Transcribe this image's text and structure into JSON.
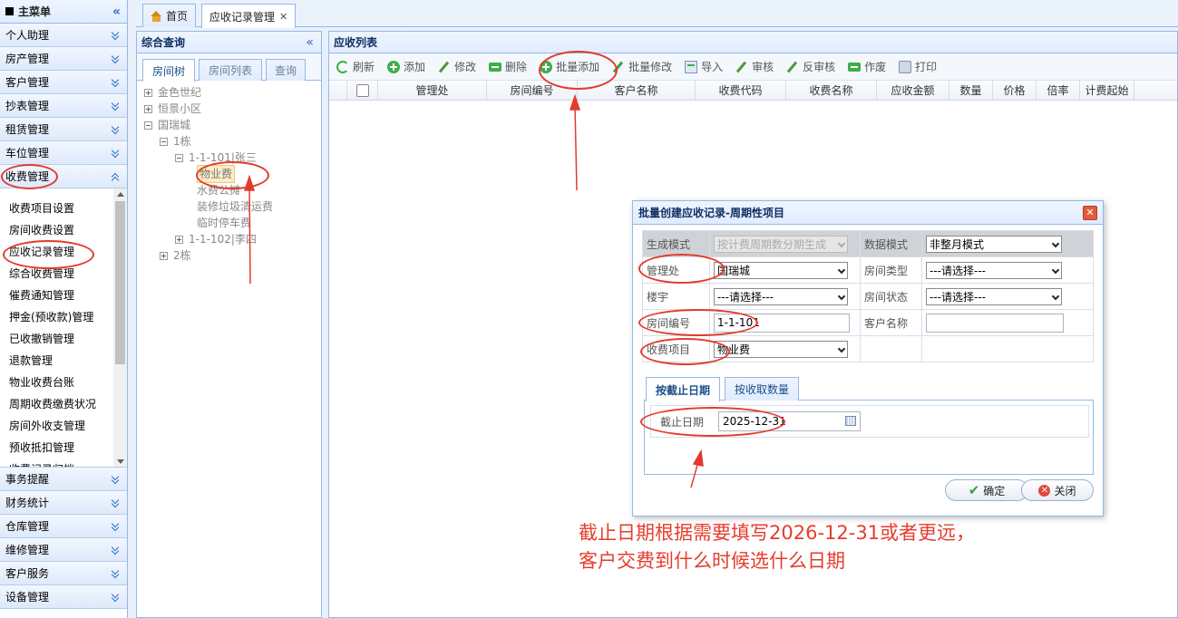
{
  "main_menu": {
    "title": "主菜单",
    "groups_top": [
      "个人助理",
      "房产管理",
      "客户管理",
      "抄表管理",
      "租赁管理",
      "车位管理"
    ],
    "open_group": "收费管理",
    "sub_items": [
      "收费项目设置",
      "房间收费设置",
      "应收记录管理",
      "综合收费管理",
      "催费通知管理",
      "押金(预收款)管理",
      "已收撤销管理",
      "退款管理",
      "物业收费台账",
      "周期收费缴费状况",
      "房间外收支管理",
      "预收抵扣管理",
      "收费记录归档"
    ],
    "groups_bottom": [
      "事务提醒",
      "财务统计",
      "仓库管理",
      "维修管理",
      "客户服务",
      "设备管理"
    ]
  },
  "top_tabs": [
    {
      "label": "首页"
    },
    {
      "label": "应收记录管理"
    }
  ],
  "search_panel": {
    "title": "综合查询",
    "tabs": [
      "房间树",
      "房间列表",
      "查询"
    ],
    "tree": [
      {
        "label": "金色世纪",
        "level": 0,
        "state": "plus"
      },
      {
        "label": "恒景小区",
        "level": 0,
        "state": "plus"
      },
      {
        "label": "国瑞城",
        "level": 0,
        "state": "minus"
      },
      {
        "label": "1栋",
        "level": 1,
        "state": "minus"
      },
      {
        "label": "1-1-101|张三",
        "level": 2,
        "state": "minus"
      },
      {
        "label": "物业费",
        "level": 3,
        "state": "selected"
      },
      {
        "label": "水费公摊",
        "level": 3,
        "state": "leaf"
      },
      {
        "label": "装修垃圾清运费",
        "level": 3,
        "state": "leaf"
      },
      {
        "label": "临时停车费",
        "level": 3,
        "state": "leaf"
      },
      {
        "label": "1-1-102|李四",
        "level": 2,
        "state": "plus"
      },
      {
        "label": "2栋",
        "level": 1,
        "state": "plus"
      }
    ]
  },
  "list_panel": {
    "title": "应收列表",
    "toolbar": [
      "刷新",
      "添加",
      "修改",
      "删除",
      "批量添加",
      "批量修改",
      "导入",
      "审核",
      "反审核",
      "作废",
      "打印"
    ],
    "columns": [
      "管理处",
      "房间编号",
      "客户名称",
      "收费代码",
      "收费名称",
      "应收金额",
      "数量",
      "价格",
      "倍率",
      "计费起始"
    ]
  },
  "dialog": {
    "title": "批量创建应收记录-周期性项目",
    "close_label": "✕",
    "fields": {
      "gen_mode_label": "生成模式",
      "gen_mode_value": "按计费周期数分期生成",
      "data_mode_label": "数据模式",
      "data_mode_value": "非整月模式",
      "office_label": "管理处",
      "office_value": "国瑞城",
      "room_type_label": "房间类型",
      "room_type_value": "---请选择---",
      "building_label": "楼宇",
      "building_value": "---请选择---",
      "room_state_label": "房间状态",
      "room_state_value": "---请选择---",
      "room_no_label": "房间编号",
      "room_no_value": "1-1-101",
      "customer_label": "客户名称",
      "customer_value": "",
      "charge_item_label": "收费项目",
      "charge_item_value": "物业费"
    },
    "tabs": [
      "按截止日期",
      "按收取数量"
    ],
    "end_date_label": "截止日期",
    "end_date_value": "2025-12-31",
    "ok_label": "确定",
    "cancel_label": "关闭"
  },
  "annotation": {
    "line1": "截止日期根据需要填写2026-12-31或者更远，",
    "line2": "客户交费到什么时候选什么日期",
    "color": "#e23b2e"
  }
}
